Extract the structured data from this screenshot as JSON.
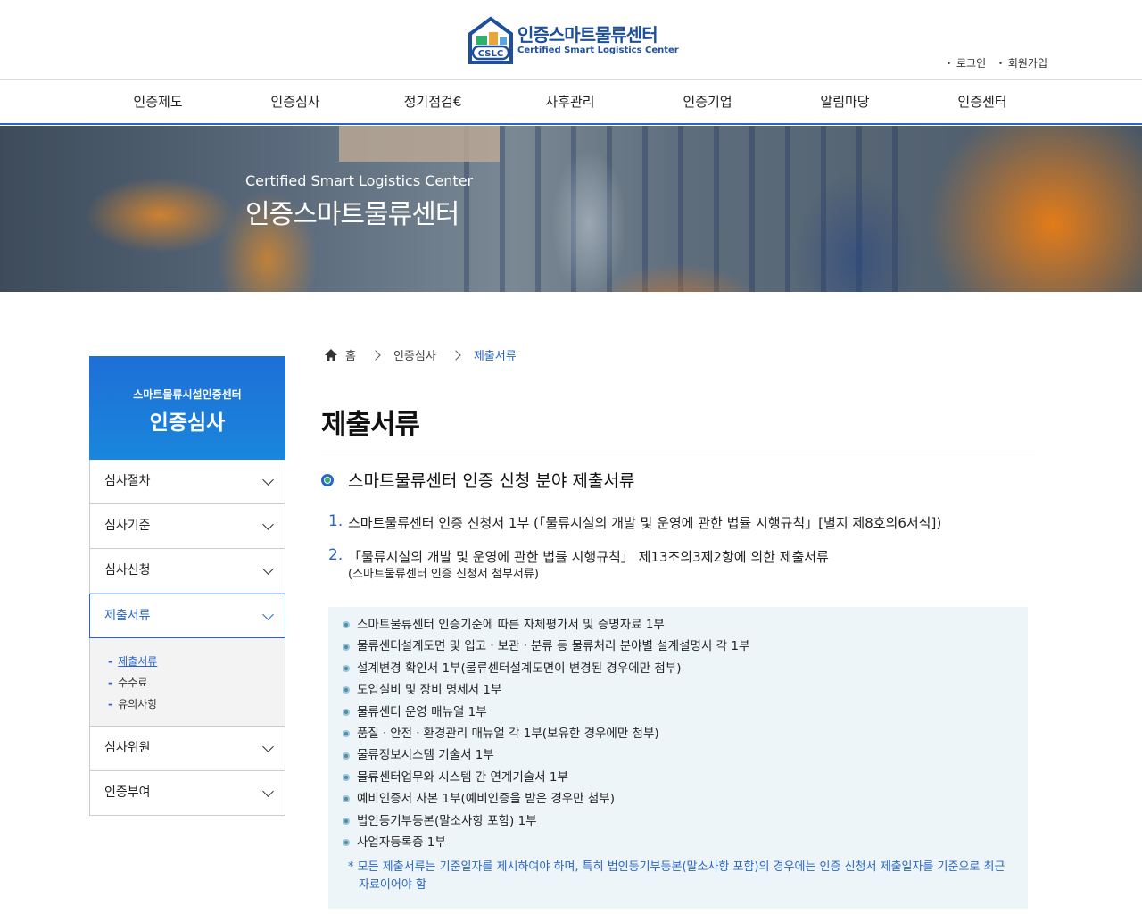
{
  "header": {
    "logo_ko": "인증스마트물류센터",
    "logo_en": "Certified Smart Logistics Center",
    "logo_mark": "CSLC",
    "util": [
      "로그인",
      "회원가입"
    ]
  },
  "gnb": [
    "인증제도",
    "인증심사",
    "정기점검€",
    "사후관리",
    "인증기업",
    "알림마당",
    "인증센터"
  ],
  "banner": {
    "en": "Certified Smart Logistics Center",
    "ko": "인증스마트물류센터"
  },
  "sidebar": {
    "sub_title": "스마트물류시설인증센터",
    "title": "인증심사",
    "items": [
      "심사절차",
      "심사기준",
      "심사신청",
      "제출서류"
    ],
    "sub_items": [
      "제출서류",
      "수수료",
      "유의사항"
    ],
    "items_after": [
      "심사위원",
      "인증부여"
    ]
  },
  "breadcrumb": {
    "home": "홈",
    "level1": "인증심사",
    "current": "제출서류"
  },
  "content": {
    "title": "제출서류",
    "section": "스마트물류센터 인증 신청 분야 제출서류",
    "ol": [
      {
        "num": "1.",
        "text": "스마트물류센터 인증 신청서 1부 (「물류시설의 개발 및 운영에 관한 법률 시행규칙」[별지 제8호의6서식])"
      },
      {
        "num": "2.",
        "text": "「물류시설의 개발 및 운영에 관한 법률 시행규칙」 제13조의3제2항에 의한 제출서류",
        "sub": "(스마트물류센터 인증 신청서 첨부서류)"
      }
    ],
    "list": [
      "스마트물류센터 인증기준에 따른 자체평가서 및 증명자료 1부",
      "물류센터설계도면 및 입고ㆍ보관ㆍ분류 등 물류처리 분야별 설계설명서 각 1부",
      "설계변경 확인서 1부(물류센터설계도면이 변경된 경우에만 첨부)",
      "도입설비 및 장비 명세서 1부",
      "물류센터 운영 매뉴얼 1부",
      "품질ㆍ안전ㆍ환경관리 매뉴얼 각 1부(보유한 경우에만 첨부)",
      "물류정보시스템 기술서 1부",
      "물류센터업무와 시스템 간 연계기술서 1부",
      "예비인증서 사본 1부(예비인증을 받은 경우만 첨부)",
      "법인등기부등본(말소사항 포함) 1부",
      "사업자등록증 1부"
    ],
    "note": "* 모든 제출서류는 기준일자를 제시하여야 하며, 특히 법인등기부등본(말소사항 포함)의 경우에는 인증 신청서 제출일자를 기준으로 최근 자료이어야 함"
  },
  "colors": {
    "primary": "#2a66c9",
    "box_bg": "#edf5f8"
  }
}
